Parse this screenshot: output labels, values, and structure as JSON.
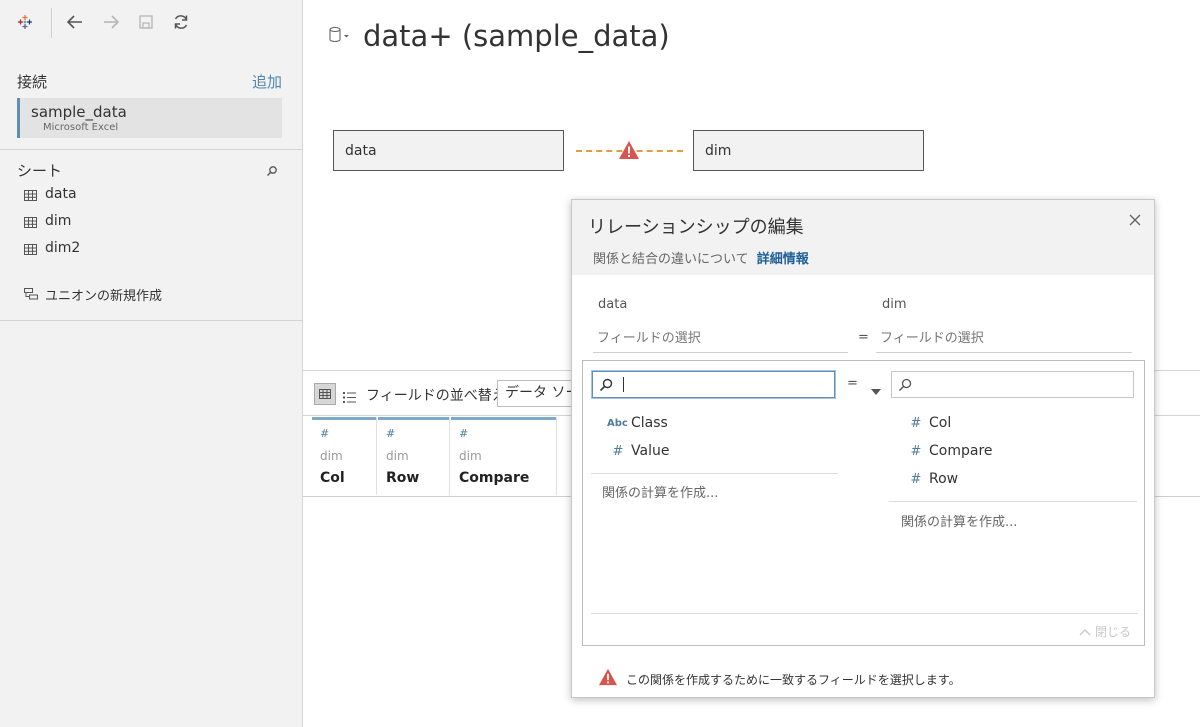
{
  "toolbar": {
    "logo_icon": "tableau-logo-icon",
    "back_icon": "back-arrow-icon",
    "forward_icon": "forward-arrow-icon",
    "save_icon": "save-icon",
    "refresh_icon": "refresh-icon"
  },
  "sidebar": {
    "connections_label": "接続",
    "add_label": "追加",
    "connection": {
      "name": "sample_data",
      "type": "Microsoft Excel"
    },
    "sheets_label": "シート",
    "sheets": [
      {
        "label": "data"
      },
      {
        "label": "dim"
      },
      {
        "label": "dim2"
      }
    ],
    "new_union_label": "ユニオンの新規作成"
  },
  "main": {
    "datasource_title": "data+ (sample_data)",
    "canvas": {
      "left_table": "data",
      "right_table": "dim",
      "warning_color": "#d9534f"
    },
    "grid_toolbar": {
      "sort_label": "フィールドの並べ替え",
      "sort_value": "データ ソー"
    },
    "fields": [
      {
        "type": "#",
        "source": "dim",
        "name": "Col"
      },
      {
        "type": "#",
        "source": "dim",
        "name": "Row"
      },
      {
        "type": "#",
        "source": "dim",
        "name": "Compare"
      }
    ]
  },
  "dialog": {
    "title": "リレーションシップの編集",
    "subtitle": "関係と結合の違いについて",
    "link": "詳細情報",
    "left_table": "data",
    "right_table": "dim",
    "left_field_placeholder": "フィールドの選択",
    "right_field_placeholder": "フィールドの選択",
    "equals": "=",
    "operator": "=",
    "left_fields": [
      {
        "type": "Abc",
        "name": "Class"
      },
      {
        "type": "#",
        "name": "Value"
      }
    ],
    "right_fields": [
      {
        "type": "#",
        "name": "Col"
      },
      {
        "type": "#",
        "name": "Compare"
      },
      {
        "type": "#",
        "name": "Row"
      }
    ],
    "create_calc_label": "関係の計算を作成...",
    "close_label": "閉じる",
    "footer_message": "この関係を作成するために一致するフィールドを選択します。",
    "accent_color": "#1f5f99"
  }
}
